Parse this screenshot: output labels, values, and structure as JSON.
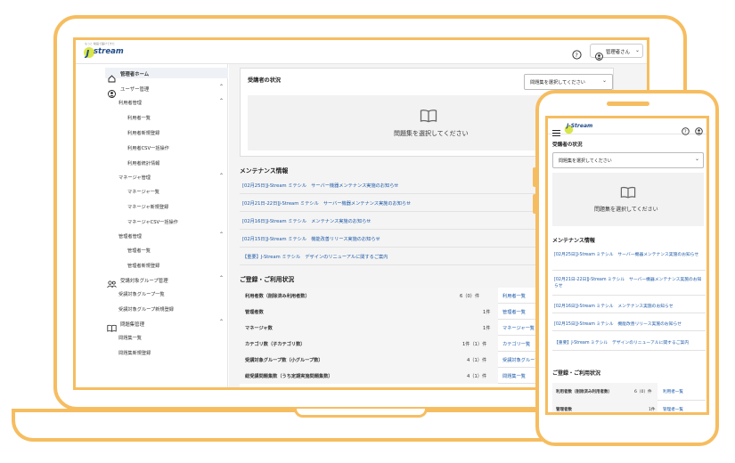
{
  "brand": {
    "tagline": "もっと 動画で届けてきた",
    "name": "J-Stream",
    "name_short": "J",
    "name_rest": "stream"
  },
  "header": {
    "help_icon": "question-circle-icon",
    "user_icon": "user-circle-icon",
    "user_label": "管理者さん",
    "dropdown_icon": "chevron-down-icon"
  },
  "sidebar": {
    "home": "管理者ホーム",
    "user_mgmt": "ユーザー管理",
    "learner_mgmt": "利用者管理",
    "learner_list": "利用者一覧",
    "learner_new": "利用者新規登録",
    "learner_csv": "利用者CSV一括操作",
    "learner_stats": "利用者統計情報",
    "manager_mgmt": "マネージャ管理",
    "manager_list": "マネージャ一覧",
    "manager_new": "マネージャ新規登録",
    "manager_csv": "マネージャCSV一括操作",
    "admin_mgmt": "管理者管理",
    "admin_list": "管理者一覧",
    "admin_new": "管理者新規登録",
    "group_mgmt": "受講対象グループ管理",
    "group_list": "受講対象グループ一覧",
    "group_new": "受講対象グループ新規登録",
    "book_mgmt": "問題集管理",
    "book_list": "問題集一覧",
    "book_new": "問題集新規登録"
  },
  "status": {
    "title": "受講者の状況",
    "select_placeholder": "問題集を選択してください",
    "empty_text": "問題集を選択してください"
  },
  "maintenance": {
    "title": "メンテナンス情報",
    "items": [
      "[02月25日]J-Stream ミテシル　サーバー機器メンテナンス実施のお知らせ",
      "[02月21日-22日]J-Stream ミテシル　サーバー機器メンテナンス実施のお知らせ",
      "[02月16日]J-Stream ミテシル　メンテナンス実施のお知らせ",
      "[02月15日]J-Stream ミテシル　機能改善リリース実施のお知らせ",
      "【重要】J-Stream ミテシル　デザインのリニューアルに関するご案内"
    ],
    "phone_items": [
      "[02月25日]J-Stream ミテシル　サーバー機器メンテナンス実施のお知らせ",
      "[02月21日-22日]J-Stream ミテシル　サーバー機器メンテナンス実施のお知らせ",
      "[02月16日]J-Stream ミテシル　メンテナンス実施のお知らせ",
      "[02月15日]J-Stream ミテシル　機能改善リリース実施のお知らせ",
      "【重要】J-Stream ミテシル　デザインのリニューアルに関するご案内"
    ]
  },
  "usage": {
    "title": "ご登録・ご利用状況",
    "rows": [
      {
        "label": "利用者数（削除済み利用者数）",
        "value": "6（0）件",
        "link": "利用者一覧"
      },
      {
        "label": "管理者数",
        "value": "1件",
        "link": "管理者一覧"
      },
      {
        "label": "マネージャ数",
        "value": "1件",
        "link": "マネージャ一覧"
      },
      {
        "label": "カテゴリ数（子カテゴリ数）",
        "value": "1件（1）件",
        "link": "カテゴリ一覧"
      },
      {
        "label": "受講対象グループ数（小グループ数）",
        "value": "4（1）件",
        "link": "受講対象グループ"
      },
      {
        "label": "総受講問題集数（うち定期実施問題集数）",
        "value": "4（1）件",
        "link": "問題集一覧"
      }
    ],
    "phone_rows": [
      {
        "label": "利用者数（削除済み利用者数）",
        "value": "6（0）件",
        "link": "利用者一覧"
      },
      {
        "label": "管理者数",
        "value": "1件",
        "link": "管理者一覧"
      }
    ]
  },
  "phone": {
    "menu_icon": "hamburger-icon",
    "brand": "J-Stream"
  },
  "colors": {
    "frame": "#f6bd60",
    "link": "#1e5aa8",
    "brand": "#1f4a8a"
  }
}
